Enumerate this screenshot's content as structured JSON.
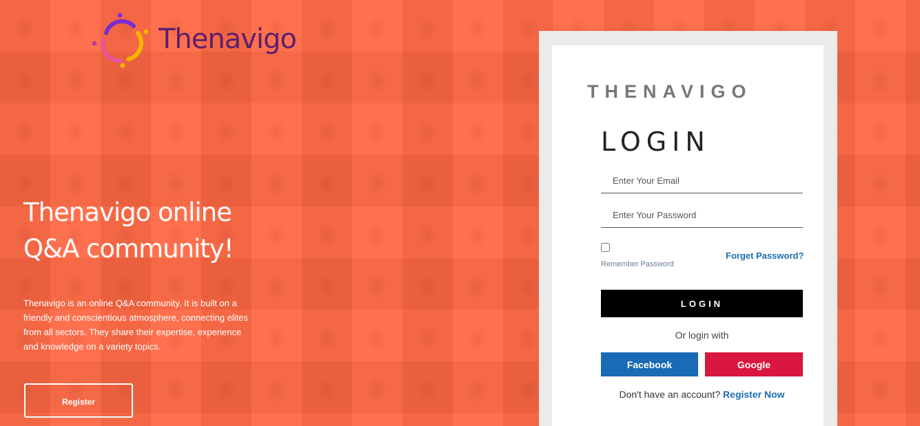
{
  "brand": {
    "logo_text": "Thenavigo",
    "colors": {
      "primary": "#5b1f6e",
      "accent_orange": "#ff6540"
    }
  },
  "hero": {
    "title_line1": "Thenavigo online",
    "title_line2": "Q&A community!",
    "description": "Thenavigo is an online Q&A community. It is built on a friendly and conscientious atmosphere, connecting elites from all sectors. They share their expertise, experience and knowledge on a variety topics.",
    "register_label": "Register"
  },
  "login_panel": {
    "brand_title": "THENAVIGO",
    "heading": "LOGIN",
    "email_placeholder": "Enter Your Email",
    "password_placeholder": "Enter Your Password",
    "remember_label": "Remember Password",
    "remember_checked": false,
    "forget_label": "Forget Password?",
    "login_button": "LOGIN",
    "or_text": "Or login with",
    "facebook_label": "Facebook",
    "google_label": "Google",
    "signup_prompt": "Don't have an account?",
    "signup_link": "Register Now",
    "colors": {
      "facebook": "#1a6bb5",
      "google": "#d8163e",
      "login_button": "#000000",
      "link": "#1c6db0"
    }
  }
}
